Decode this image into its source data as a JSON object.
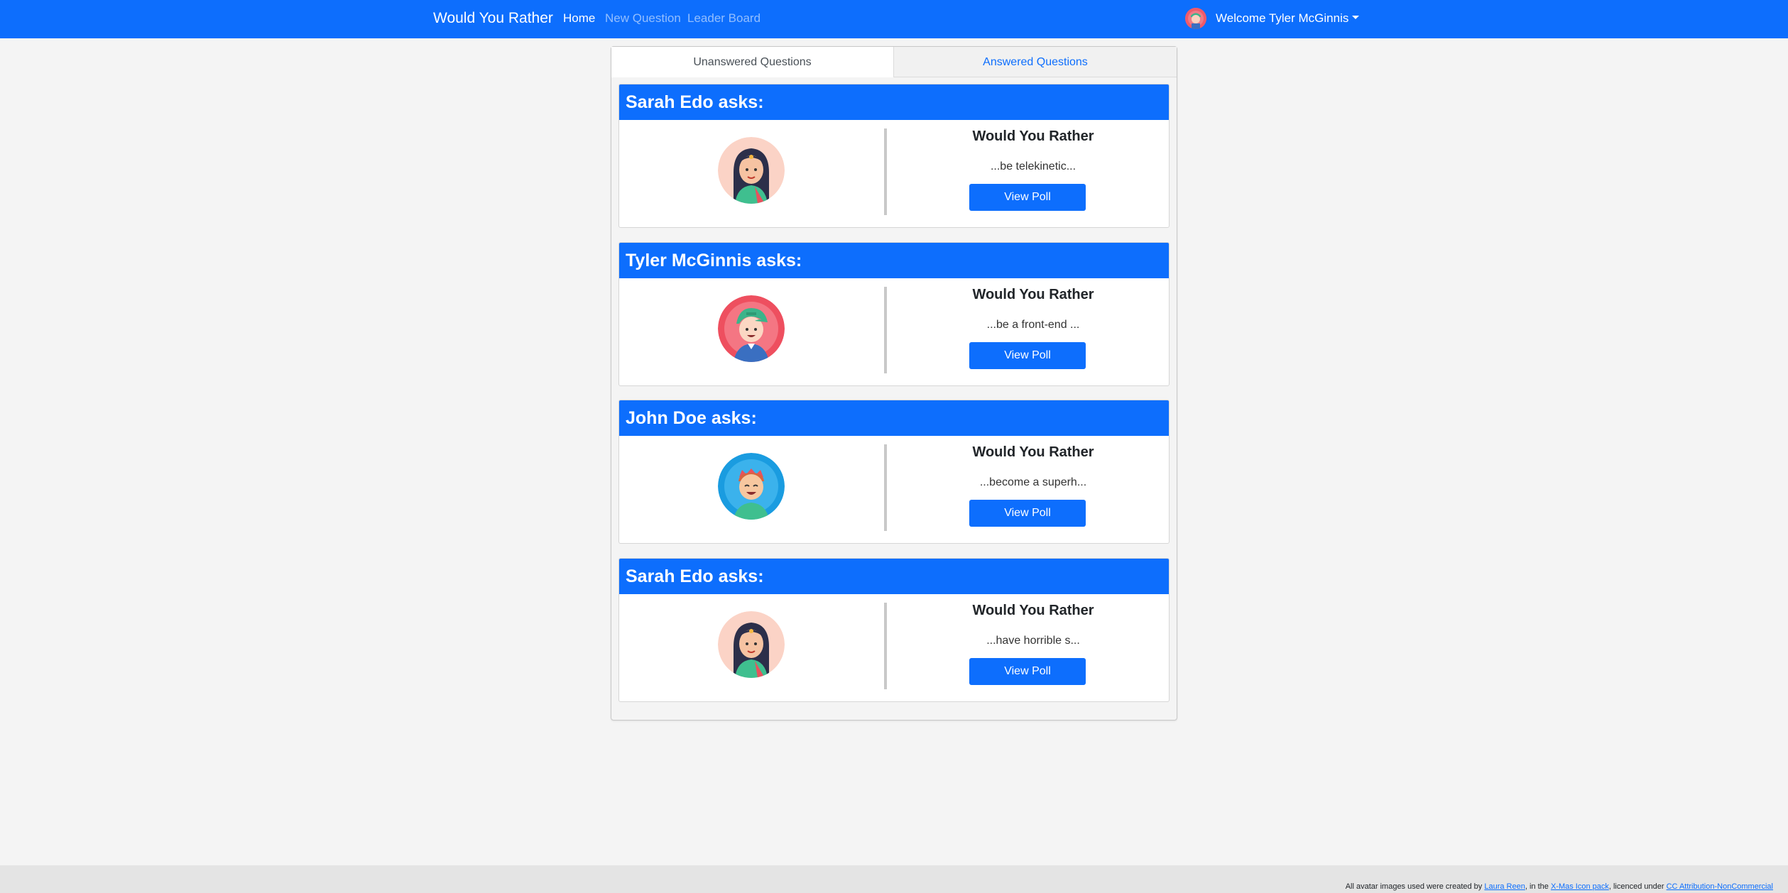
{
  "navbar": {
    "brand": "Would You Rather",
    "links": [
      "Home",
      "New Question",
      "Leader Board"
    ],
    "user_greeting": "Welcome Tyler McGinnis",
    "accent_color": "#0d6efd"
  },
  "tabs": {
    "unanswered": "Unanswered Questions",
    "answered": "Answered Questions"
  },
  "questions": [
    {
      "author": "Sarah Edo asks:",
      "title": "Would You Rather",
      "option": "...be telekinetic...",
      "button": "View Poll",
      "avatar": "woman-avatar-icon"
    },
    {
      "author": "Tyler McGinnis asks:",
      "title": "Would You Rather",
      "option": "...be a front-end ...",
      "button": "View Poll",
      "avatar": "boy-cap-avatar-icon"
    },
    {
      "author": "John Doe asks:",
      "title": "Would You Rather",
      "option": "...become a superh...",
      "button": "View Poll",
      "avatar": "boy-crown-avatar-icon"
    },
    {
      "author": "Sarah Edo asks:",
      "title": "Would You Rather",
      "option": "...have horrible s...",
      "button": "View Poll",
      "avatar": "woman-avatar-icon"
    }
  ],
  "footer": {
    "prefix": "All avatar images used were created by",
    "author_link": "Laura Reen",
    "middle": ", in the",
    "pack_link": "X-Mas Icon pack",
    "licence_text": ", licenced under",
    "licence_link": "CC Attribution-NonCommercial"
  }
}
